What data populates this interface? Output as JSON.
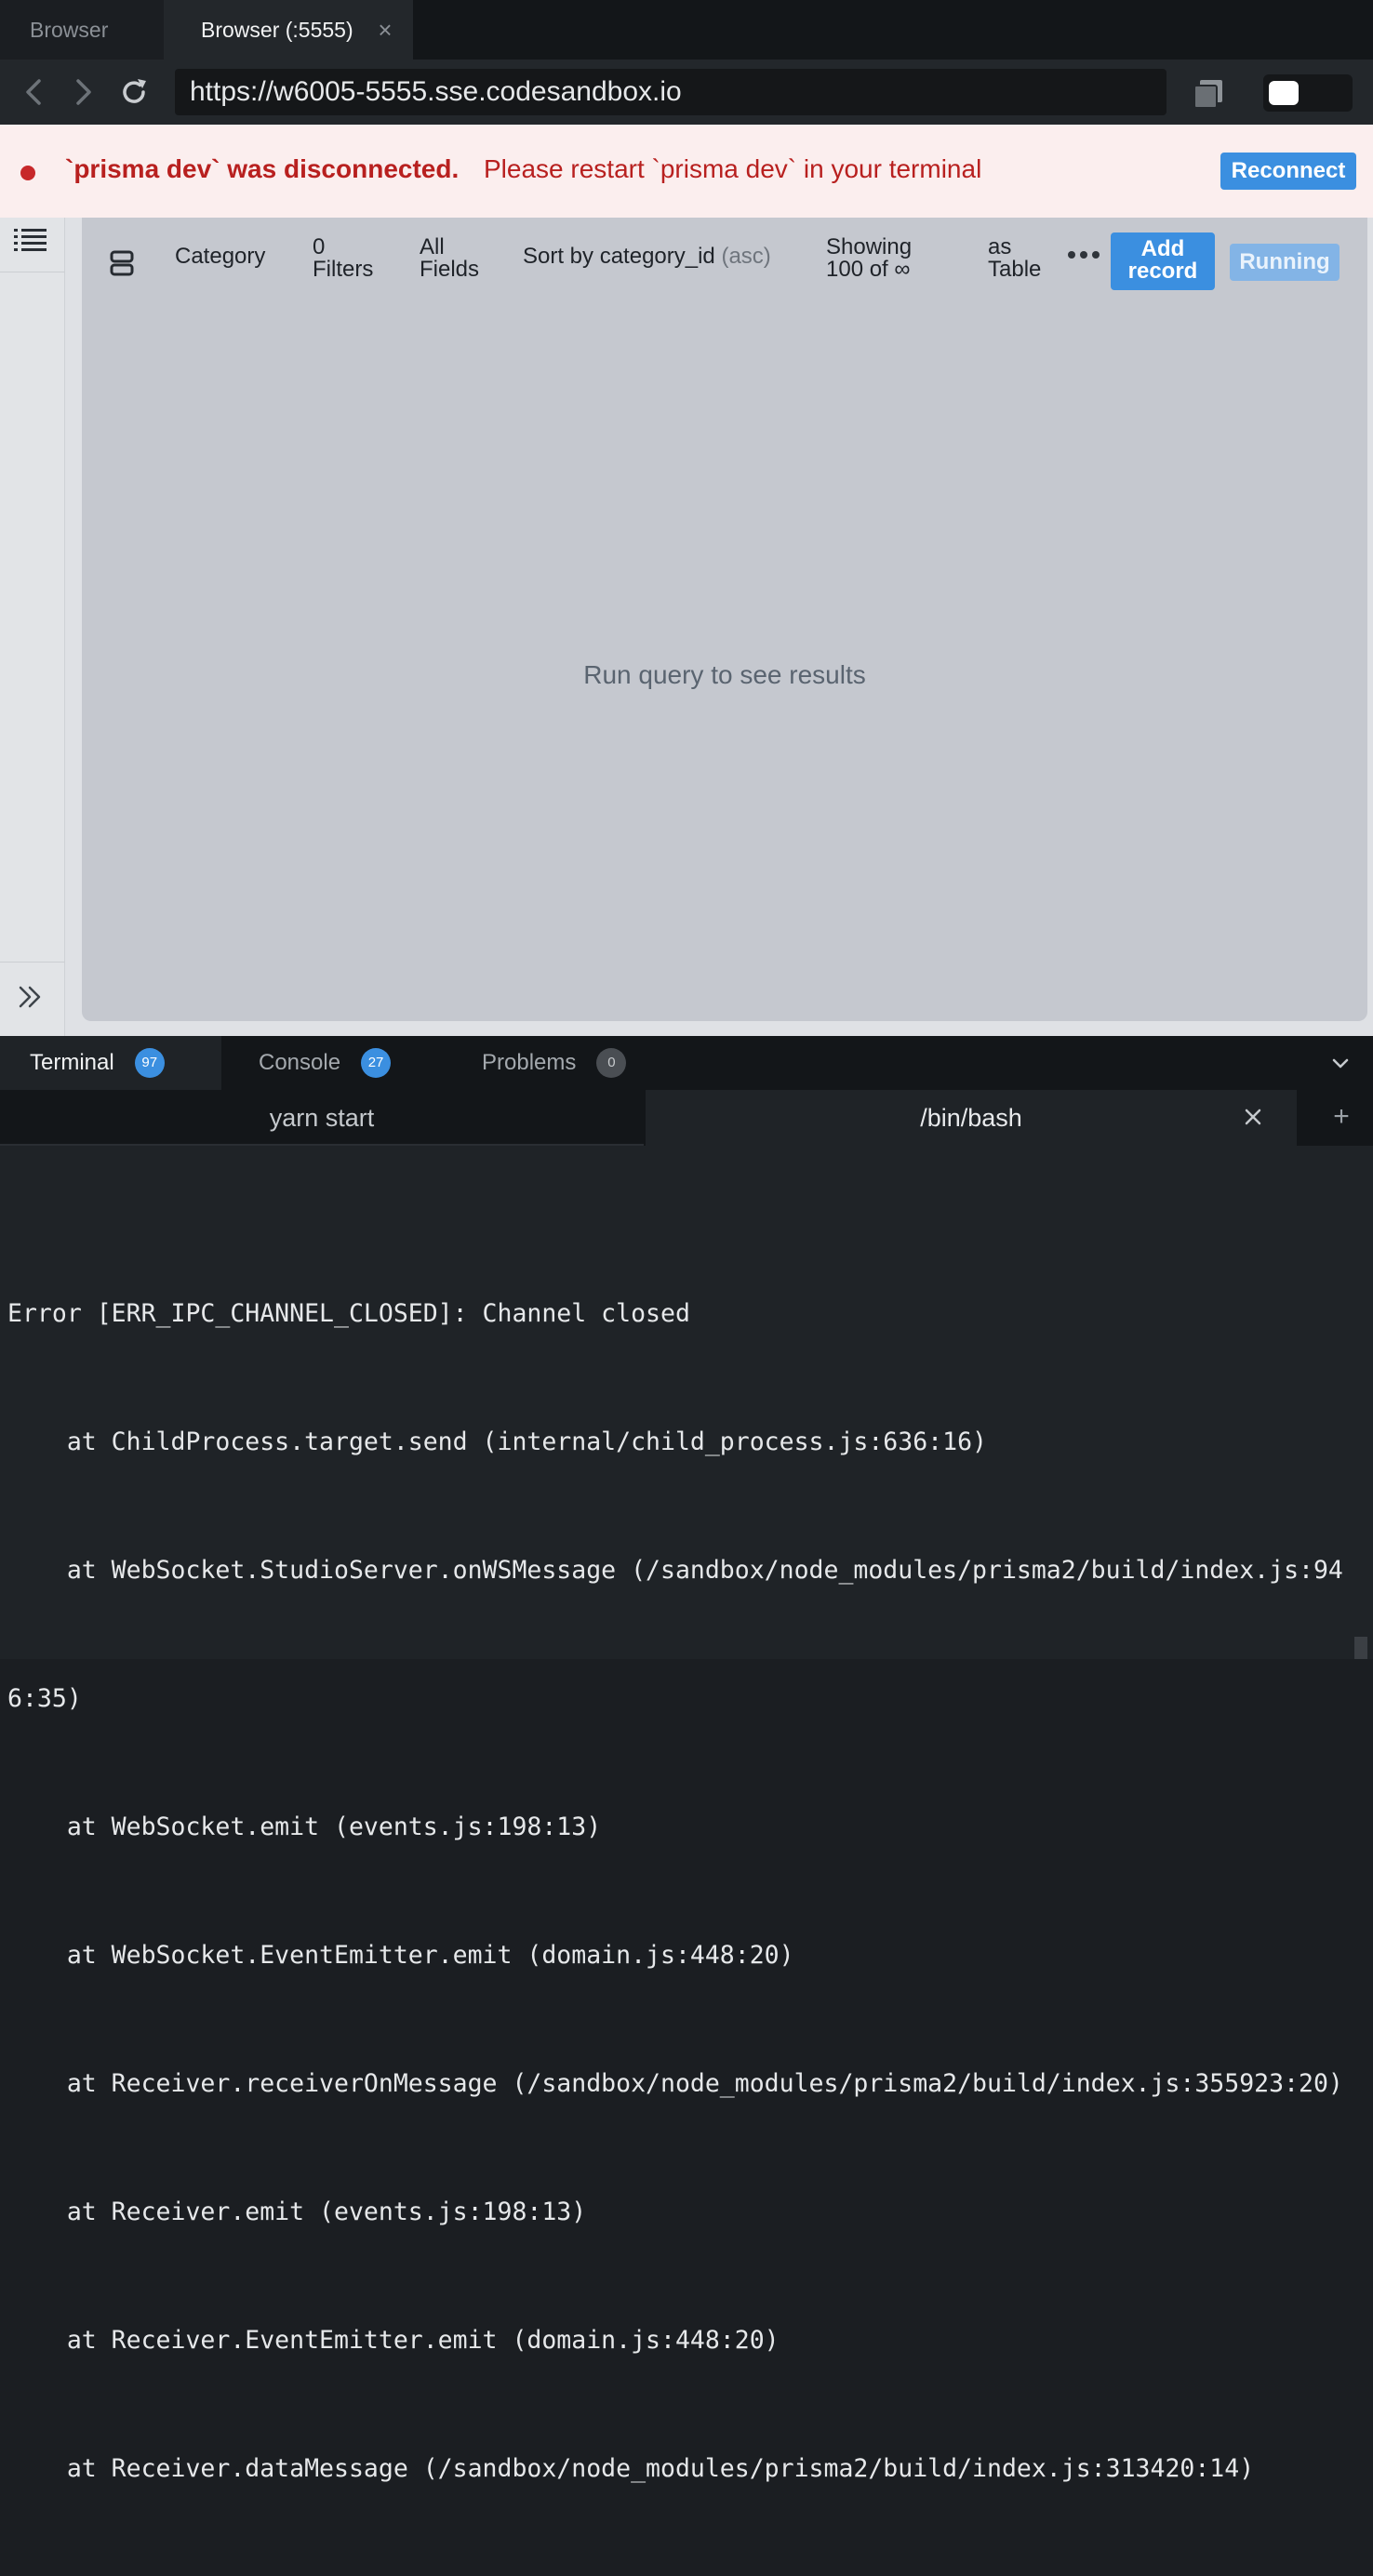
{
  "browser": {
    "tabs": [
      {
        "label": "Browser",
        "active": false
      },
      {
        "label": "Browser (:5555)",
        "active": true
      }
    ],
    "url": "https://w6005-5555.sse.codesandbox.io"
  },
  "banner": {
    "strong_text": "`prisma dev` was disconnected.",
    "message": "Please restart `prisma dev` in your terminal",
    "reconnect_label": "Reconnect"
  },
  "studio": {
    "toolbar": {
      "model": "Category",
      "filters_count": "0",
      "filters_label": "Filters",
      "fields_line1": "All",
      "fields_line2": "Fields",
      "sort_label": "Sort by category_id",
      "sort_order": "(asc)",
      "showing_line1": "Showing",
      "showing_line2": "100 of ∞",
      "view_line1": "as",
      "view_line2": "Table",
      "add_record_line1": "Add",
      "add_record_line2": "record",
      "running_label": "Running"
    },
    "empty_message": "Run query to see results"
  },
  "bottom_panel": {
    "tabs": [
      {
        "label": "Terminal",
        "badge": "97"
      },
      {
        "label": "Console",
        "badge": "27"
      },
      {
        "label": "Problems",
        "badge": "0"
      }
    ],
    "terminal_tabs": [
      {
        "label": "yarn start"
      },
      {
        "label": "/bin/bash"
      }
    ],
    "add_symbol": "+",
    "output": [
      "Error [ERR_IPC_CHANNEL_CLOSED]: Channel closed",
      "    at ChildProcess.target.send (internal/child_process.js:636:16)",
      "    at WebSocket.StudioServer.onWSMessage (/sandbox/node_modules/prisma2/build/index.js:94",
      "6:35)",
      "    at WebSocket.emit (events.js:198:13)",
      "    at WebSocket.EventEmitter.emit (domain.js:448:20)",
      "    at Receiver.receiverOnMessage (/sandbox/node_modules/prisma2/build/index.js:355923:20)",
      "    at Receiver.emit (events.js:198:13)",
      "    at Receiver.EventEmitter.emit (domain.js:448:20)",
      "    at Receiver.dataMessage (/sandbox/node_modules/prisma2/build/index.js:313420:14)"
    ]
  },
  "colors": {
    "accent": "#3b8fe0",
    "error": "#b8201f",
    "banner_bg": "#fbeeee",
    "terminal_bg": "#1f2327"
  }
}
